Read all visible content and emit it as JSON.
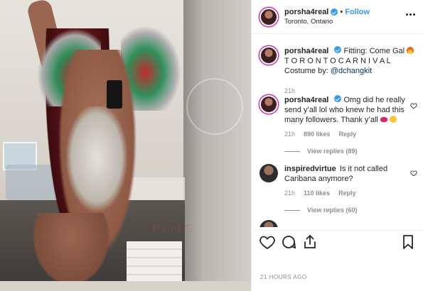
{
  "post": {
    "photo_watermark": "Paint S",
    "photo_watermark_note": "",
    "header": {
      "username": "porsha4real",
      "follow_label": "Follow",
      "separator": "•",
      "location": "Toronto, Ontario"
    },
    "comments": [
      {
        "username": "porsha4real",
        "text_before": "Fitting: Come Gal",
        "text_after": " T O R O N T O C A R N I V A L",
        "text_line2": "Costume by: ",
        "mention": "@dchangkit",
        "time": "21h"
      },
      {
        "username": "porsha4real",
        "text": "Omg did he really send y’all lol who knew he had this many followers. Thank y’all",
        "time": "21h",
        "likes": "890 likes",
        "reply_label": "Reply",
        "view_replies": "View replies (89)"
      },
      {
        "username": "inspiredvirtue",
        "text": "Is it not called Caribana anymore?",
        "time": "21h",
        "likes": "110 likes",
        "reply_label": "Reply",
        "view_replies": "View replies (60)"
      }
    ],
    "timestamp": "21 HOURS AGO"
  },
  "icons": [
    "verified-icon",
    "more-options-icon",
    "fire-emoji-icon",
    "heart-icon",
    "comment-icon",
    "share-icon",
    "bookmark-icon"
  ],
  "colors": {
    "link_blue": "#3897f0",
    "text": "#262626",
    "muted": "#8e8e8e",
    "border": "#efefef"
  }
}
